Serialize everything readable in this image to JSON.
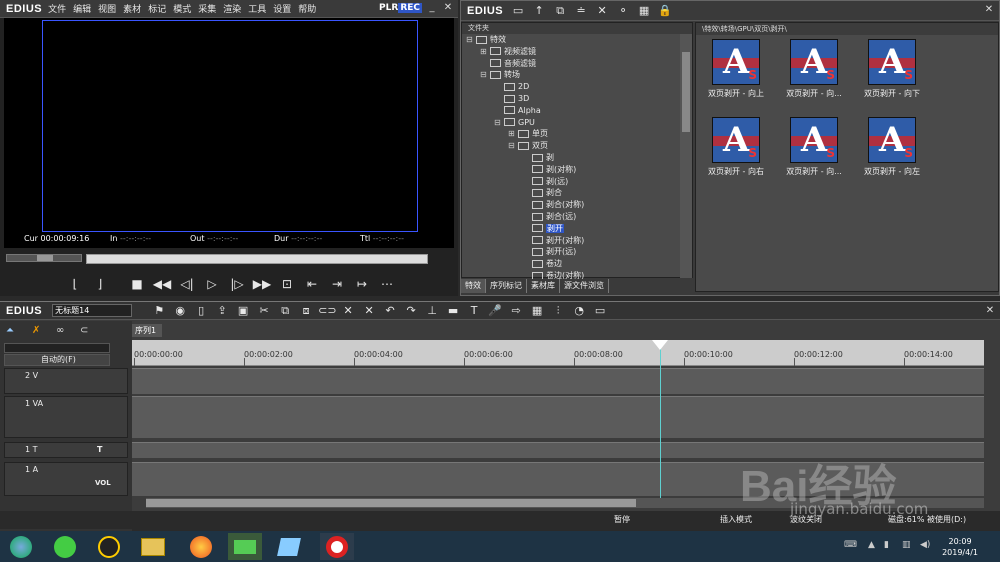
{
  "player": {
    "logo": "EDIUS",
    "menu": [
      "文件",
      "编辑",
      "视图",
      "素材",
      "标记",
      "模式",
      "采集",
      "渲染",
      "工具",
      "设置",
      "帮助"
    ],
    "plr": "PLR",
    "rec": "REC",
    "timecodes": {
      "cur_label": "Cur",
      "cur_value": "00:00:09:16",
      "in_label": "In",
      "in_value": "--:--:--:--",
      "out_label": "Out",
      "out_value": "--:--:--:--",
      "dur_label": "Dur",
      "dur_value": "--:--:--:--",
      "ttl_label": "Ttl",
      "ttl_value": "--:--:--:--"
    }
  },
  "effects_panel": {
    "logo": "EDIUS",
    "folder_title": "文件夹",
    "tree": [
      {
        "label": "特效",
        "depth": 0,
        "expander": "⊟"
      },
      {
        "label": "视频滤镜",
        "depth": 1,
        "expander": "⊞"
      },
      {
        "label": "音频滤镜",
        "depth": 1,
        "expander": ""
      },
      {
        "label": "转场",
        "depth": 1,
        "expander": "⊟"
      },
      {
        "label": "2D",
        "depth": 2,
        "expander": ""
      },
      {
        "label": "3D",
        "depth": 2,
        "expander": ""
      },
      {
        "label": "Alpha",
        "depth": 2,
        "expander": ""
      },
      {
        "label": "GPU",
        "depth": 2,
        "expander": "⊟"
      },
      {
        "label": "单页",
        "depth": 3,
        "expander": "⊞"
      },
      {
        "label": "双页",
        "depth": 3,
        "expander": "⊟"
      },
      {
        "label": "剥",
        "depth": 4,
        "expander": ""
      },
      {
        "label": "剥(对称)",
        "depth": 4,
        "expander": ""
      },
      {
        "label": "剥(远)",
        "depth": 4,
        "expander": ""
      },
      {
        "label": "剥合",
        "depth": 4,
        "expander": ""
      },
      {
        "label": "剥合(对称)",
        "depth": 4,
        "expander": ""
      },
      {
        "label": "剥合(远)",
        "depth": 4,
        "expander": ""
      },
      {
        "label": "剥开",
        "depth": 4,
        "expander": "",
        "selected": true
      },
      {
        "label": "剥开(对称)",
        "depth": 4,
        "expander": ""
      },
      {
        "label": "剥开(远)",
        "depth": 4,
        "expander": ""
      },
      {
        "label": "卷边",
        "depth": 4,
        "expander": ""
      },
      {
        "label": "卷边(对称)",
        "depth": 4,
        "expander": ""
      }
    ],
    "tabs": [
      "特效",
      "序列标记",
      "素材库",
      "源文件浏览"
    ],
    "path": "\\特效\\转场\\GPU\\双页\\剥开\\",
    "tiles": [
      "双页剥开 - 向上",
      "双页剥开 - 向...",
      "双页剥开 - 向下",
      "双页剥开 - 向右",
      "双页剥开 - 向...",
      "双页剥开 - 向左"
    ]
  },
  "timeline": {
    "logo": "EDIUS",
    "project_name": "无标题14",
    "sequence_tab": "序列1",
    "auto_mode": "自动的(F)",
    "ruler": [
      "00:00:00:00",
      "00:00:02:00",
      "00:00:04:00",
      "00:00:06:00",
      "00:00:08:00",
      "00:00:10:00",
      "00:00:12:00",
      "00:00:14:00"
    ],
    "tracks": [
      {
        "label": "2 V"
      },
      {
        "label": "1 VA"
      },
      {
        "label": "1 T"
      },
      {
        "label": "1 A"
      }
    ],
    "vol": "VOL",
    "t_icon": "T"
  },
  "status": {
    "paused": "暂停",
    "insert_mode": "插入模式",
    "ripple": "波纹关闭",
    "disk": "磁盘:61% 被使用(D:)"
  },
  "taskbar": {
    "time": "20:09",
    "date": "2019/4/1"
  },
  "watermark": {
    "brand": "Bai经验",
    "url": "jingyan.baidu.com"
  },
  "colors": {
    "accent": "#2f56c6",
    "cursor": "#5fd0d0"
  }
}
